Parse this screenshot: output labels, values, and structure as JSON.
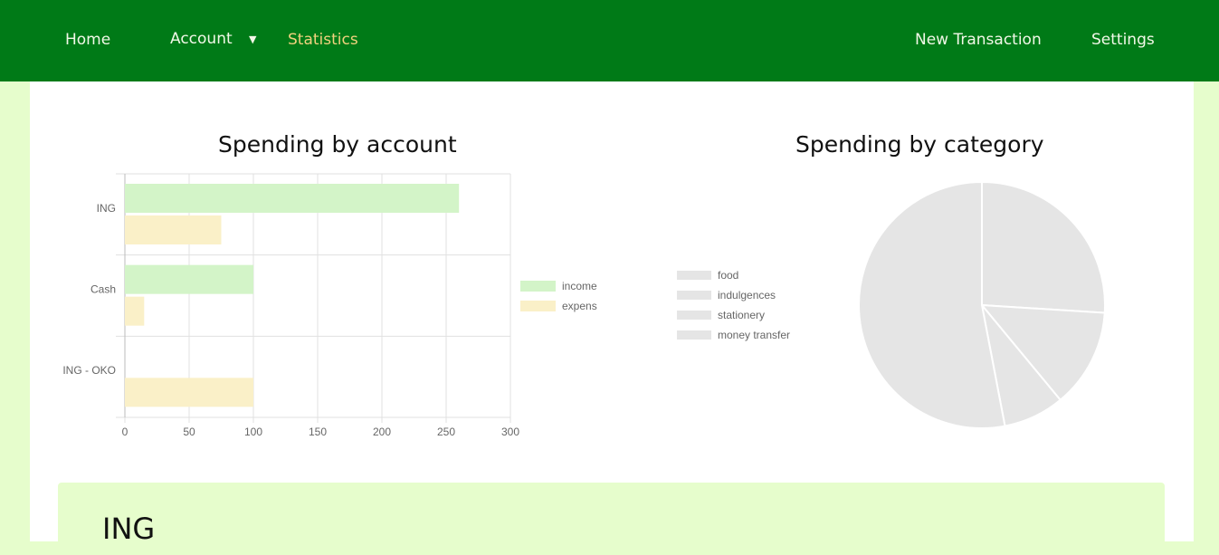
{
  "nav": {
    "home": "Home",
    "account": "Account",
    "statistics": "Statistics",
    "new_transaction": "New Transaction",
    "settings": "Settings"
  },
  "colors": {
    "navbar": "#007a17",
    "active_link": "#f0d27e",
    "income": "#d3f4c8",
    "expense": "#faf0c8",
    "pie_slice": "#e5e5e5"
  },
  "charts": {
    "bar_title": "Spending by account",
    "pie_title": "Spending by category"
  },
  "chart_data": [
    {
      "type": "bar",
      "orientation": "horizontal",
      "title": "Spending by account",
      "categories": [
        "ING",
        "Cash",
        "ING - OKO"
      ],
      "series": [
        {
          "name": "income",
          "values": [
            260,
            100,
            0
          ]
        },
        {
          "name": "expense",
          "values": [
            75,
            15,
            100
          ]
        }
      ],
      "xlim": [
        0,
        300
      ],
      "xticks": [
        "0",
        "50",
        "100",
        "150",
        "200",
        "250",
        "300"
      ],
      "grid": true,
      "legend": "right"
    },
    {
      "type": "pie",
      "title": "Spending by category",
      "labels": [
        "food",
        "indulgences",
        "stationery",
        "money transfer"
      ],
      "values": [
        26,
        13,
        8,
        53
      ],
      "legend": "left"
    }
  ],
  "account_section": {
    "title": "ING"
  }
}
